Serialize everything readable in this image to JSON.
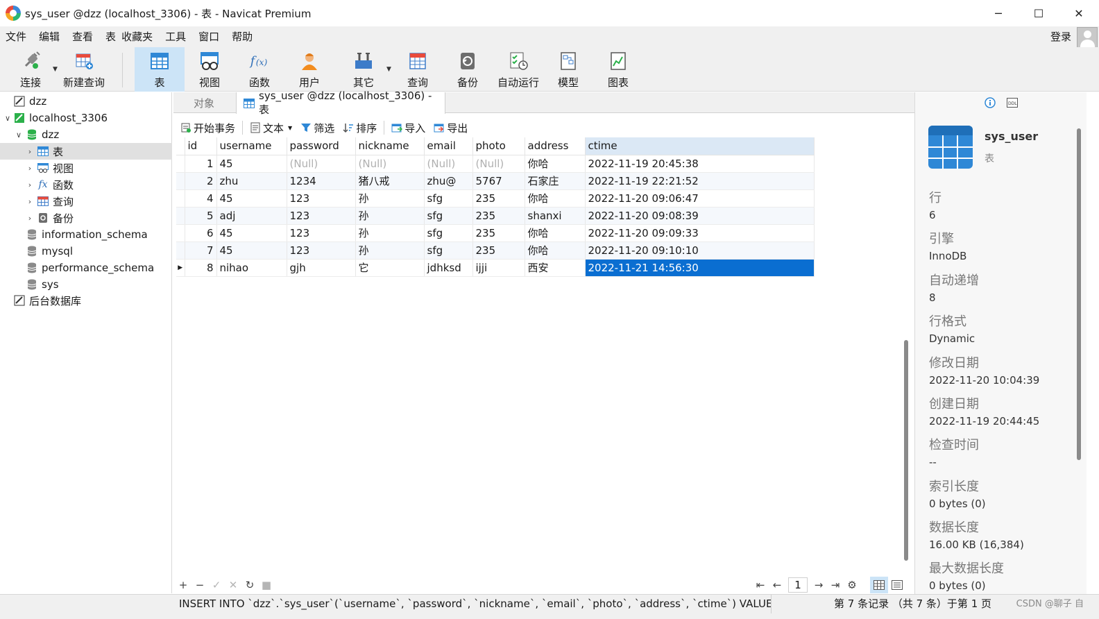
{
  "window": {
    "title": "sys_user @dzz (localhost_3306) - 表 - Navicat Premium",
    "minimize": "─",
    "maximize": "☐",
    "close": "✕"
  },
  "menu": {
    "items": [
      "文件",
      "编辑",
      "查看",
      "表",
      "收藏夹",
      "工具",
      "窗口",
      "帮助"
    ],
    "login": "登录"
  },
  "toolbar": {
    "connect": "连接",
    "new_query": "新建查询",
    "table": "表",
    "view": "视图",
    "function": "函数",
    "user": "用户",
    "other": "其它",
    "query": "查询",
    "backup": "备份",
    "autorun": "自动运行",
    "model": "模型",
    "chart": "图表"
  },
  "tree": {
    "items": [
      {
        "label": "dzz"
      },
      {
        "label": "localhost_3306"
      },
      {
        "label": "dzz"
      },
      {
        "label": "表"
      },
      {
        "label": "视图"
      },
      {
        "label": "函数"
      },
      {
        "label": "查询"
      },
      {
        "label": "备份"
      },
      {
        "label": "information_schema"
      },
      {
        "label": "mysql"
      },
      {
        "label": "performance_schema"
      },
      {
        "label": "sys"
      },
      {
        "label": "后台数据库"
      }
    ],
    "fx_glyph": "fx"
  },
  "tabs": {
    "objects": "对象",
    "active": "sys_user @dzz (localhost_3306) - 表"
  },
  "subtoolbar": {
    "begin_transaction": "开始事务",
    "text": "文本",
    "filter": "筛选",
    "sort": "排序",
    "import": "导入",
    "export": "导出"
  },
  "grid": {
    "columns": [
      "id",
      "username",
      "password",
      "nickname",
      "email",
      "photo",
      "address",
      "ctime"
    ],
    "rows": [
      [
        "1",
        "45",
        "(Null)",
        "(Null)",
        "(Null)",
        "(Null)",
        "你哈",
        "2022-11-19 20:45:38"
      ],
      [
        "2",
        "zhu",
        "1234",
        "猪八戒",
        "zhu@",
        "5767",
        "石家庄",
        "2022-11-19 22:21:52"
      ],
      [
        "4",
        "45",
        "123",
        "孙",
        "sfg",
        "235",
        "你哈",
        "2022-11-20 09:06:47"
      ],
      [
        "5",
        "adj",
        "123",
        "孙",
        "sfg",
        "235",
        "shanxi",
        "2022-11-20 09:08:39"
      ],
      [
        "6",
        "45",
        "123",
        "孙",
        "sfg",
        "235",
        "你哈",
        "2022-11-20 09:09:33"
      ],
      [
        "7",
        "45",
        "123",
        "孙",
        "sfg",
        "235",
        "你哈",
        "2022-11-20 09:10:10"
      ],
      [
        "8",
        "nihao",
        "gjh",
        "它",
        "jdhksd",
        "ijji",
        "西安",
        "2022-11-21 14:56:30"
      ]
    ],
    "current_row_marker": "▶"
  },
  "footer": {
    "add": "+",
    "remove": "−",
    "apply": "✓",
    "discard": "✕",
    "refresh": "↻",
    "stop": "■",
    "first": "⇤",
    "prev": "←",
    "page": "1",
    "next": "→",
    "last": "⇥",
    "settings": "⚙"
  },
  "status": {
    "sql": "INSERT INTO `dzz`.`sys_user`(`username`, `password`, `nickname`, `email`, `photo`, `address`, `ctime`) VALUES ('nihao', 'gjh",
    "record": "第 7 条记录 （共 7 条）于第 1 页",
    "watermark": "CSDN @聊子 自"
  },
  "info": {
    "name": "sys_user",
    "type": "表",
    "fields": [
      {
        "label": "行",
        "value": "6"
      },
      {
        "label": "引擎",
        "value": "InnoDB"
      },
      {
        "label": "自动递增",
        "value": "8"
      },
      {
        "label": "行格式",
        "value": "Dynamic"
      },
      {
        "label": "修改日期",
        "value": "2022-11-20 10:04:39"
      },
      {
        "label": "创建日期",
        "value": "2022-11-19 20:44:45"
      },
      {
        "label": "检查时间",
        "value": "--"
      },
      {
        "label": "索引长度",
        "value": "0 bytes (0)"
      },
      {
        "label": "数据长度",
        "value": "16.00 KB (16,384)"
      },
      {
        "label": "最大数据长度",
        "value": "0 bytes (0)"
      }
    ]
  },
  "colors": {
    "accent": "#0a6ed1",
    "toolbar_active": "#cce4f7",
    "db_green": "#2bb04a"
  }
}
